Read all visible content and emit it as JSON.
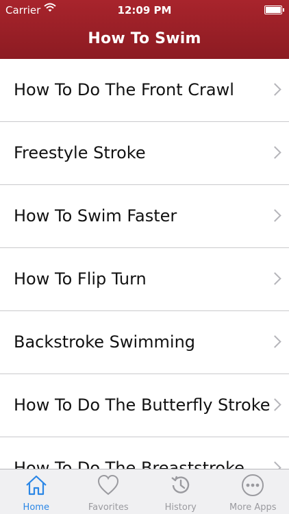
{
  "status_bar": {
    "carrier": "Carrier",
    "time": "12:09 PM"
  },
  "nav": {
    "title": "How To Swim"
  },
  "list": {
    "items": [
      {
        "label": "How To Do The Front Crawl"
      },
      {
        "label": "Freestyle Stroke"
      },
      {
        "label": "How To Swim Faster"
      },
      {
        "label": "How To Flip Turn"
      },
      {
        "label": "Backstroke Swimming"
      },
      {
        "label": "How To Do The Butterfly Stroke"
      },
      {
        "label": "How To Do The Breaststroke"
      }
    ]
  },
  "tabbar": {
    "tabs": [
      {
        "label": "Home",
        "icon": "home-icon",
        "active": true
      },
      {
        "label": "Favorites",
        "icon": "heart-icon",
        "active": false
      },
      {
        "label": "History",
        "icon": "history-icon",
        "active": false
      },
      {
        "label": "More Apps",
        "icon": "more-icon",
        "active": false
      }
    ]
  },
  "colors": {
    "header": "#9c2028",
    "active_tab": "#2a86e6",
    "inactive_tab": "#9a9a9f"
  }
}
